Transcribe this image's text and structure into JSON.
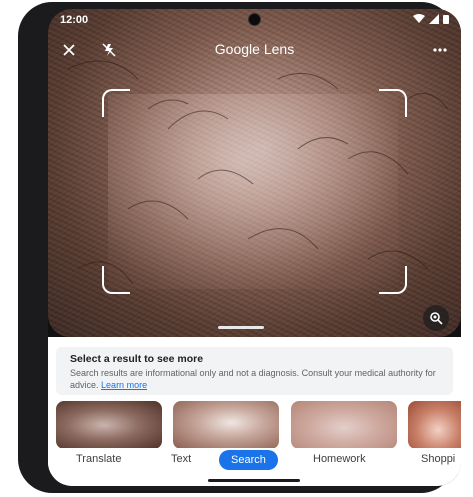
{
  "status_bar": {
    "time": "12:00"
  },
  "app_bar": {
    "title": "Google Lens"
  },
  "info_card": {
    "title": "Select a result to see more",
    "text": "Search results are informational only and not a diagnosis. Consult your medical authority for advice.",
    "link": "Learn more"
  },
  "tabs": [
    {
      "label": "Translate",
      "active": false
    },
    {
      "label": "Text",
      "active": false
    },
    {
      "label": "Search",
      "active": true
    },
    {
      "label": "Homework",
      "active": false
    },
    {
      "label": "Shoppi",
      "active": false
    }
  ],
  "colors": {
    "accent": "#1a73e8"
  },
  "icons": {
    "close": "close-icon",
    "flash_off": "flash-off-icon",
    "more": "more-vert-icon",
    "lens_search": "lens-search-icon"
  }
}
